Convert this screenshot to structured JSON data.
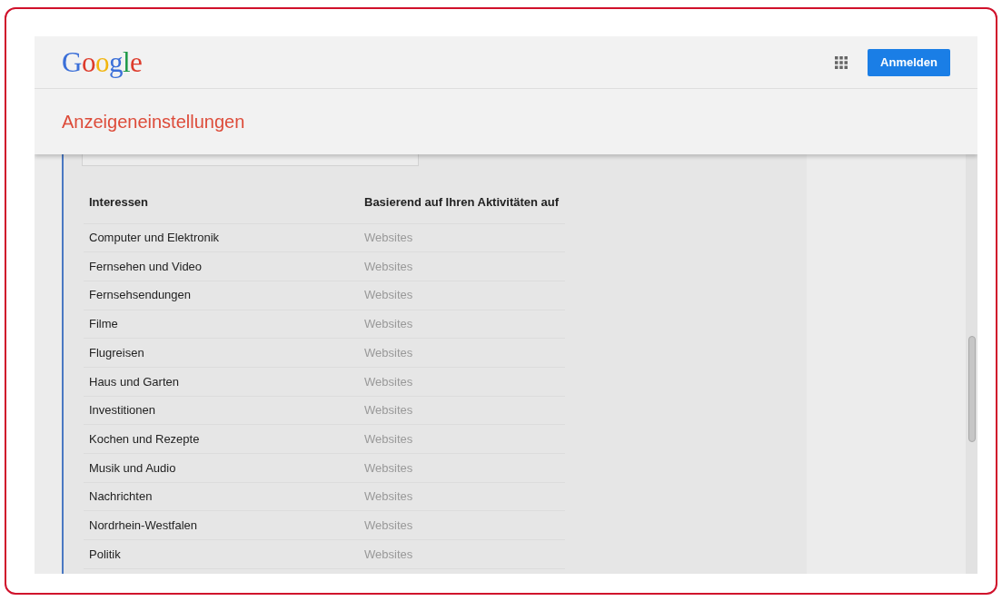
{
  "header": {
    "logo": "Google",
    "signin_button": "Anmelden"
  },
  "page_title": "Anzeigeneinstellungen",
  "table": {
    "columns": [
      "Interessen",
      "Basierend auf Ihren Aktivitäten auf"
    ],
    "rows": [
      [
        "Computer und Elektronik",
        "Websites"
      ],
      [
        "Fernsehen und Video",
        "Websites"
      ],
      [
        "Fernsehsendungen",
        "Websites"
      ],
      [
        "Filme",
        "Websites"
      ],
      [
        "Flugreisen",
        "Websites"
      ],
      [
        "Haus und Garten",
        "Websites"
      ],
      [
        "Investitionen",
        "Websites"
      ],
      [
        "Kochen und Rezepte",
        "Websites"
      ],
      [
        "Musik und Audio",
        "Websites"
      ],
      [
        "Nachrichten",
        "Websites"
      ],
      [
        "Nordrhein-Westfalen",
        "Websites"
      ],
      [
        "Politik",
        "Websites"
      ]
    ]
  }
}
